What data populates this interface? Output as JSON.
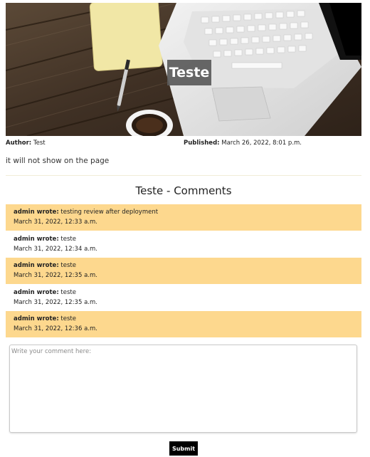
{
  "post": {
    "title": "Teste",
    "author_label": "Author:",
    "author": "Test",
    "published_label": "Published:",
    "published": "March 26, 2022, 8:01 p.m.",
    "body": "it will not show on the page"
  },
  "comments_section": {
    "heading": "Teste - Comments",
    "comments": [
      {
        "author": "admin wrote:",
        "text": "testing review after deployment",
        "date": "March 31, 2022, 12:33 a.m."
      },
      {
        "author": "admin wrote:",
        "text": "teste",
        "date": "March 31, 2022, 12:34 a.m."
      },
      {
        "author": "admin wrote:",
        "text": "teste",
        "date": "March 31, 2022, 12:35 a.m."
      },
      {
        "author": "admin wrote:",
        "text": "teste",
        "date": "March 31, 2022, 12:35 a.m."
      },
      {
        "author": "admin wrote:",
        "text": "teste",
        "date": "March 31, 2022, 12:36 a.m."
      }
    ]
  },
  "form": {
    "placeholder": "Write your comment here:",
    "value": "",
    "submit_label": "Submit"
  },
  "colors": {
    "comment_highlight": "#fdd88e",
    "button_bg": "#000000"
  }
}
